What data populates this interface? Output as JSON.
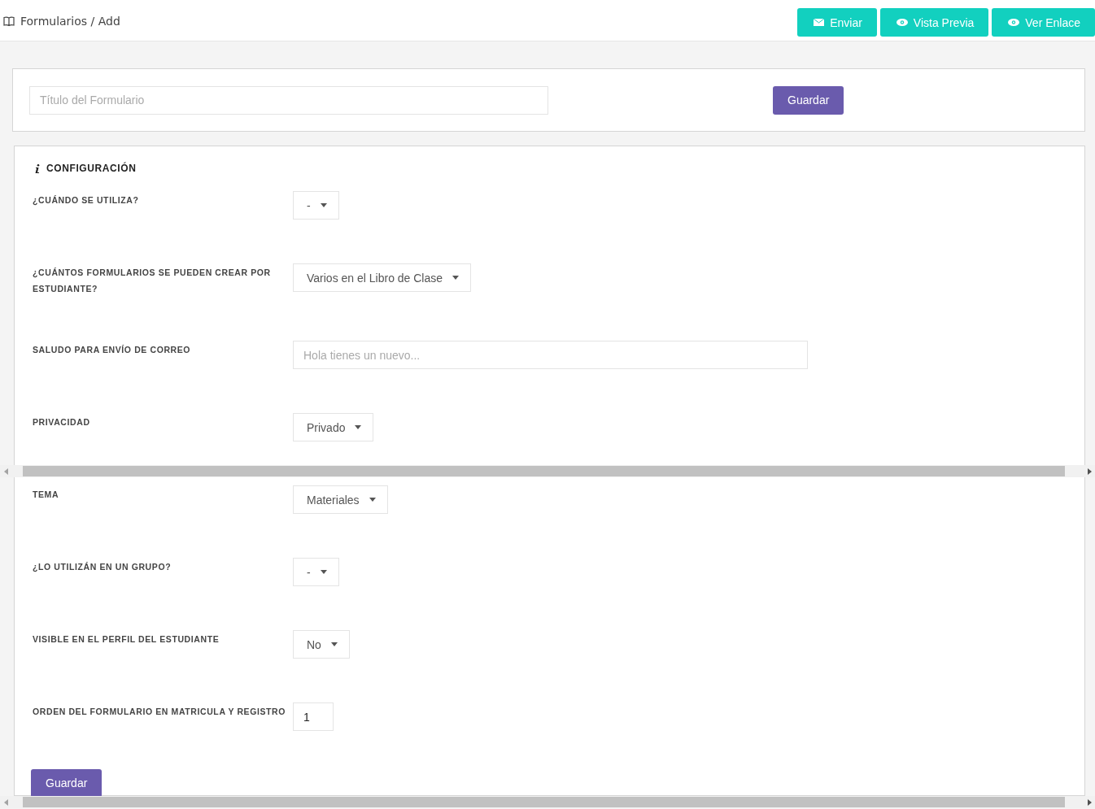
{
  "header": {
    "breadcrumb": "Formularios / Add",
    "buttons": [
      {
        "label": "Enviar",
        "kind": "mail"
      },
      {
        "label": "Vista Previa",
        "kind": "eye"
      },
      {
        "label": "Ver Enlace",
        "kind": "eye"
      }
    ]
  },
  "title_card": {
    "placeholder": "Título del Formulario",
    "button": "Guardar"
  },
  "config": {
    "title": "CONFIGURACIÓN",
    "fields": [
      {
        "label": "¿CUÁNDO SE UTILIZA?",
        "kind": "select",
        "value": "-"
      },
      {
        "label": "¿CUÁNTOS FORMULARIOS SE PUEDEN CREAR POR ESTUDIANTE?",
        "kind": "select",
        "value": "Varios en el Libro de Clase"
      },
      {
        "label": "SALUDO PARA ENVÍO DE CORREO",
        "kind": "text",
        "placeholder": "Hola tienes un nuevo..."
      },
      {
        "label": "PRIVACIDAD",
        "kind": "select",
        "value": "Privado"
      },
      {
        "label": "TEMA",
        "kind": "select",
        "value": "Materiales"
      },
      {
        "label": "¿LO UTILIZÁN EN UN GRUPO?",
        "kind": "select",
        "value": "-"
      },
      {
        "label": "VISIBLE EN EL PERFIL DEL ESTUDIANTE",
        "kind": "select",
        "value": "No"
      },
      {
        "label": "ORDEN DEL FORMULARIO EN MATRICULA Y REGISTRO",
        "kind": "number",
        "value": "1"
      }
    ],
    "button": "Guardar"
  }
}
